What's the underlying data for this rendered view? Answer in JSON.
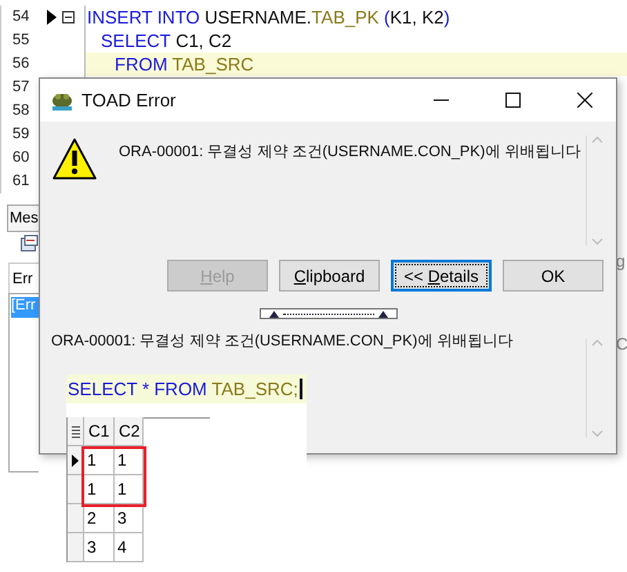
{
  "editor": {
    "lines": [
      {
        "number": "54",
        "marker": true,
        "fold": true,
        "current": false,
        "tokens": [
          {
            "text": "INSERT INTO",
            "kind": "keyword"
          },
          {
            "text": " USERNAME.",
            "kind": "plain"
          },
          {
            "text": "TAB_PK",
            "kind": "object"
          },
          {
            "text": " (",
            "kind": "keyword"
          },
          {
            "text": "K1, K2",
            "kind": "plain"
          },
          {
            "text": ")",
            "kind": "keyword"
          }
        ],
        "children": [
          {
            "number": "55",
            "marker": false,
            "fold": false,
            "current": false,
            "tokens": [
              {
                "text": "SELECT",
                "kind": "keyword"
              },
              {
                "text": " C1, C2",
                "kind": "plain"
              }
            ],
            "children": [
              {
                "number": "56",
                "marker": false,
                "fold": false,
                "current": true,
                "tokens": [
                  {
                    "text": "FROM",
                    "kind": "keyword"
                  },
                  {
                    "text": " TAB_SRC",
                    "kind": "object"
                  }
                ]
              }
            ]
          }
        ]
      },
      {
        "number": "57",
        "marker": false,
        "fold": false,
        "current": false
      },
      {
        "number": "58",
        "marker": false,
        "fold": false,
        "current": false
      },
      {
        "number": "59",
        "marker": false,
        "fold": false,
        "current": false
      },
      {
        "number": "60",
        "marker": false,
        "fold": false,
        "current": false
      },
      {
        "number": "61",
        "marker": false,
        "fold": false,
        "current": false
      }
    ]
  },
  "bottom_panel": {
    "tab": "Mes",
    "sub_tab": "Err",
    "list_items": [
      {
        "label": "[Err",
        "selected": true
      }
    ],
    "right_fragments": [
      "g",
      "C"
    ]
  },
  "dialog": {
    "title": "TOAD Error",
    "message": "ORA-00001: 무결성 제약 조건(USERNAME.CON_PK)에 위배됩니다",
    "buttons": [
      {
        "label_parts": [
          {
            "text": "H",
            "underlined": true
          },
          {
            "text": "elp",
            "underlined": false
          }
        ],
        "disabled": true,
        "focused": false
      },
      {
        "label_parts": [
          {
            "text": "C",
            "underlined": true
          },
          {
            "text": "lipboard",
            "underlined": false
          }
        ],
        "disabled": false,
        "focused": false
      },
      {
        "label_parts": [
          {
            "text": "<< ",
            "underlined": false
          },
          {
            "text": "D",
            "underlined": true
          },
          {
            "text": "etails",
            "underlined": false
          }
        ],
        "disabled": false,
        "focused": true
      },
      {
        "label_parts": [
          {
            "text": "OK",
            "underlined": false
          }
        ],
        "disabled": false,
        "focused": false
      }
    ],
    "details": "ORA-00001: 무결성 제약 조건(USERNAME.CON_PK)에 위배됩니다"
  },
  "query": {
    "tokens": [
      {
        "text": "SELECT * FROM",
        "kind": "keyword"
      },
      {
        "text": " TAB_SRC;",
        "kind": "object"
      }
    ]
  },
  "grid": {
    "columns": [
      "C1",
      "C2"
    ],
    "rows": [
      {
        "cells": [
          "1",
          "1"
        ],
        "current": true,
        "highlighted": true
      },
      {
        "cells": [
          "1",
          "1"
        ],
        "current": false,
        "highlighted": true
      },
      {
        "cells": [
          "2",
          "3"
        ],
        "current": false,
        "highlighted": false
      },
      {
        "cells": [
          "3",
          "4"
        ],
        "current": false,
        "highlighted": false
      }
    ]
  }
}
